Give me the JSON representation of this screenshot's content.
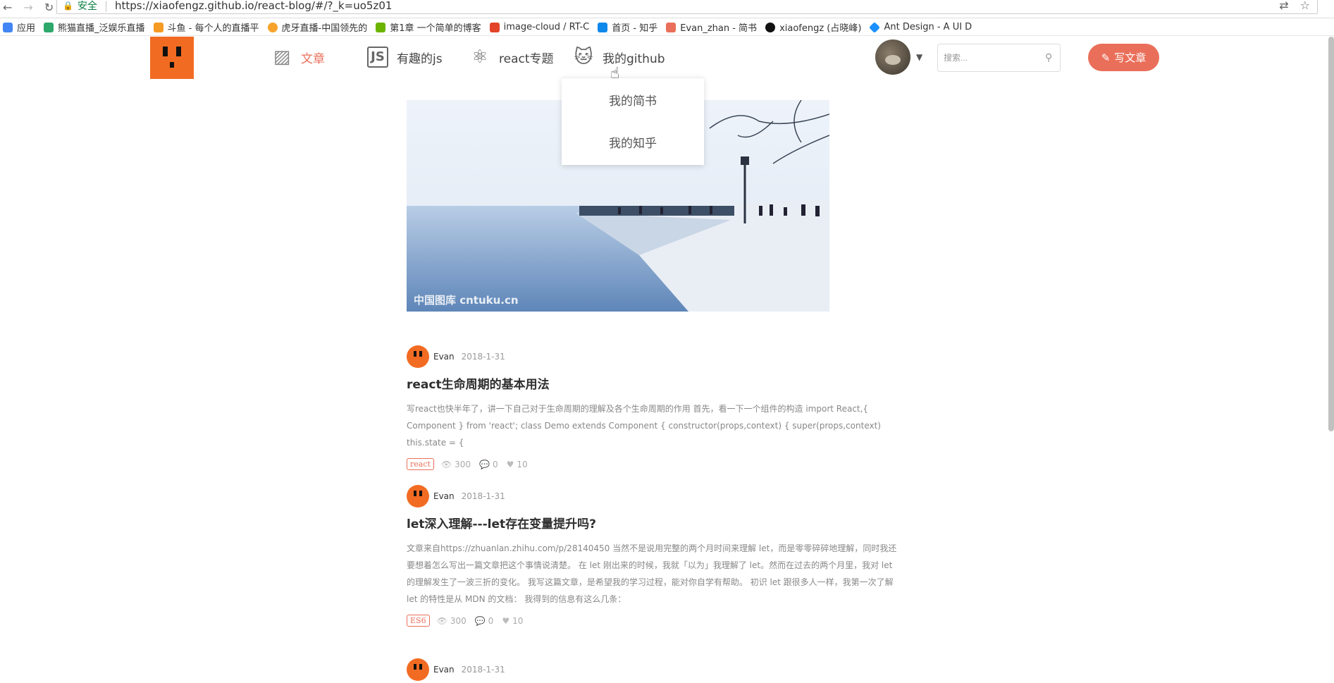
{
  "browser": {
    "secure_label": "安全",
    "url": "https://xiaofengz.github.io/react-blog/#/?_k=uo5z01",
    "bookmarks": [
      {
        "label": "应用",
        "color": "#4285f4"
      },
      {
        "label": "熊猫直播_泛娱乐直播",
        "color": "#2ea86b"
      },
      {
        "label": "斗鱼 - 每个人的直播平",
        "color": "#f59a23"
      },
      {
        "label": "虎牙直播-中国领先的",
        "color": "#f7a32b"
      },
      {
        "label": "第1章 一个简单的博客",
        "color": "#6bb400"
      },
      {
        "label": "image-cloud / RT-C",
        "color": "#e24329"
      },
      {
        "label": "首页 - 知乎",
        "color": "#0f88eb"
      },
      {
        "label": "Evan_zhan - 简书",
        "color": "#ea6f5a"
      },
      {
        "label": "xiaofengz (占晓峰)",
        "color": "#111111"
      },
      {
        "label": "Ant Design - A UI D",
        "color": "#1890ff"
      }
    ]
  },
  "nav": {
    "items": [
      {
        "label": "文章",
        "icon": "article-icon"
      },
      {
        "label": "有趣的js",
        "icon": "js-icon"
      },
      {
        "label": "react专题",
        "icon": "react-icon"
      },
      {
        "label": "我的github",
        "icon": "github-icon"
      }
    ],
    "search_placeholder": "搜索...",
    "write_label": "写文章"
  },
  "dropdown": {
    "items": [
      "我的简书",
      "我的知乎"
    ]
  },
  "banner": {
    "watermark": "中国图库 cntuku.cn"
  },
  "articles": [
    {
      "author": "Evan",
      "date": "2018-1-31",
      "title": "react生命周期的基本用法",
      "abstract": "写react也快半年了，讲一下自己对于生命周期的理解及各个生命周期的作用 首先，看一下一个组件的构造 import React,{ Component } from 'react'; class Demo extends Component { constructor(props,context) { super(props,context) this.state = {",
      "tag": "react",
      "views": "300",
      "comments": "0",
      "likes": "10"
    },
    {
      "author": "Evan",
      "date": "2018-1-31",
      "title": "let深入理解---let存在变量提升吗?",
      "abstract": "文章来自https://zhuanlan.zhihu.com/p/28140450 当然不是说用完整的两个月时间来理解 let，而是零零碎碎地理解，同时我还要想着怎么写出一篇文章把这个事情说清楚。 在 let 刚出来的时候，我就「以为」我理解了 let。然而在过去的两个月里，我对 let 的理解发生了一波三折的变化。 我写这篇文章，是希望我的学习过程，能对你自学有帮助。 初识 let 跟很多人一样，我第一次了解 let 的特性是从 MDN 的文档： 我得到的信息有这么几条：",
      "tag": "ES6",
      "views": "300",
      "comments": "0",
      "likes": "10"
    },
    {
      "author": "Evan",
      "date": "2018-1-31"
    }
  ]
}
